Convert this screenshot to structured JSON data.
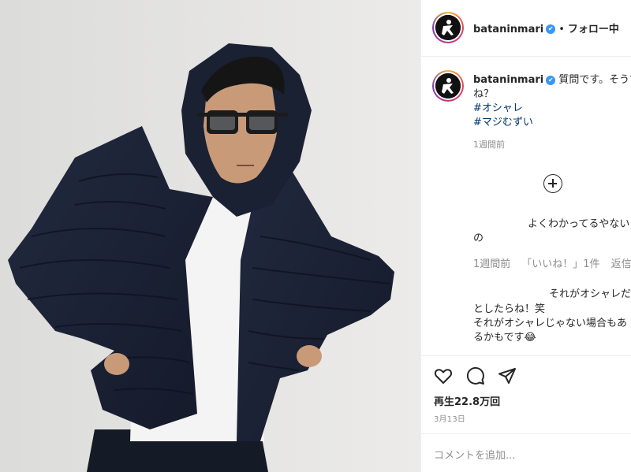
{
  "post": {
    "username": "bataninmari",
    "verified_mark": "✔",
    "follow_separator": "•",
    "follow_label": "フォロー中"
  },
  "caption": {
    "username": "bataninmari",
    "line1": "質問です。そうで",
    "line2": "ね？",
    "tag1": "#オシャレ",
    "tag2": "#マジむずい",
    "time": "1週間前"
  },
  "load_more_icon": "plus-circle-icon",
  "replies": [
    {
      "line1": "よくわかってるやない",
      "line2": "の",
      "time": "1週間前",
      "likes": "「いいね！」1件",
      "reply_label": "返信"
    },
    {
      "line1": "それがオシャレだ",
      "line2": "としたらね！笑",
      "line3": "それがオシャレじゃない場合もあ",
      "line4": "るかもです😂"
    }
  ],
  "actions": {
    "icons": [
      "heart-icon",
      "comment-icon",
      "share-icon"
    ],
    "views": "再生22.8万回",
    "date": "3月13日"
  },
  "add_comment": {
    "placeholder": "コメントを追加..."
  },
  "colors": {
    "link_blue": "#00376b",
    "verified_blue": "#3897f0",
    "muted": "#8e8e8e",
    "background_wall": "#e7e7e5",
    "jacket_navy": "#1b2236"
  }
}
